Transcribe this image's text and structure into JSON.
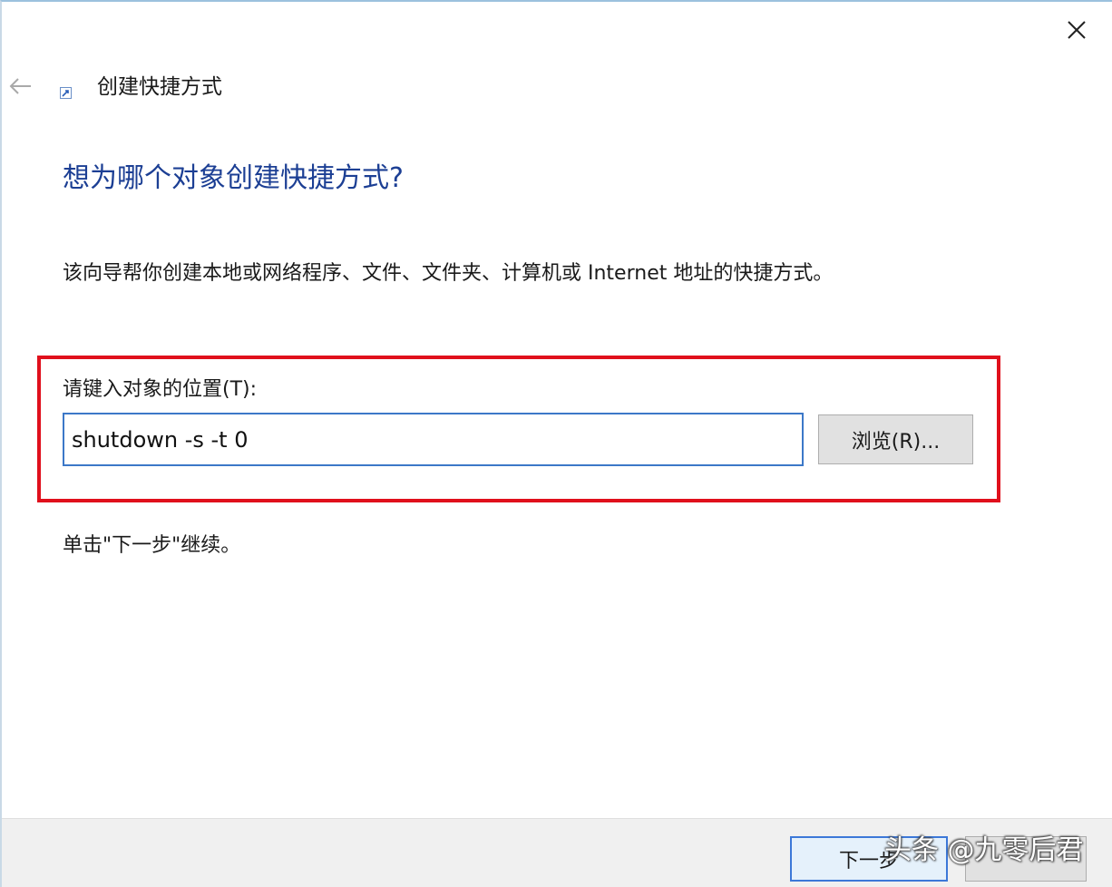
{
  "window": {
    "title": "创建快捷方式"
  },
  "content": {
    "heading": "想为哪个对象创建快捷方式?",
    "description": "该向导帮你创建本地或网络程序、文件、文件夹、计算机或 Internet 地址的快捷方式。",
    "location_label": "请键入对象的位置(T):",
    "location_value": "shutdown -s -t 0",
    "browse_label": "浏览(R)...",
    "hint": "单击\"下一步\"继续。"
  },
  "footer": {
    "next_label": "下一步",
    "watermark": "头条 @九零后君"
  },
  "icons": {
    "close": "close-icon",
    "back": "back-arrow-icon",
    "wizard": "shortcut-icon"
  },
  "colors": {
    "heading": "#1c3f94",
    "highlight": "#e0101c",
    "input_border": "#3c78c8"
  }
}
